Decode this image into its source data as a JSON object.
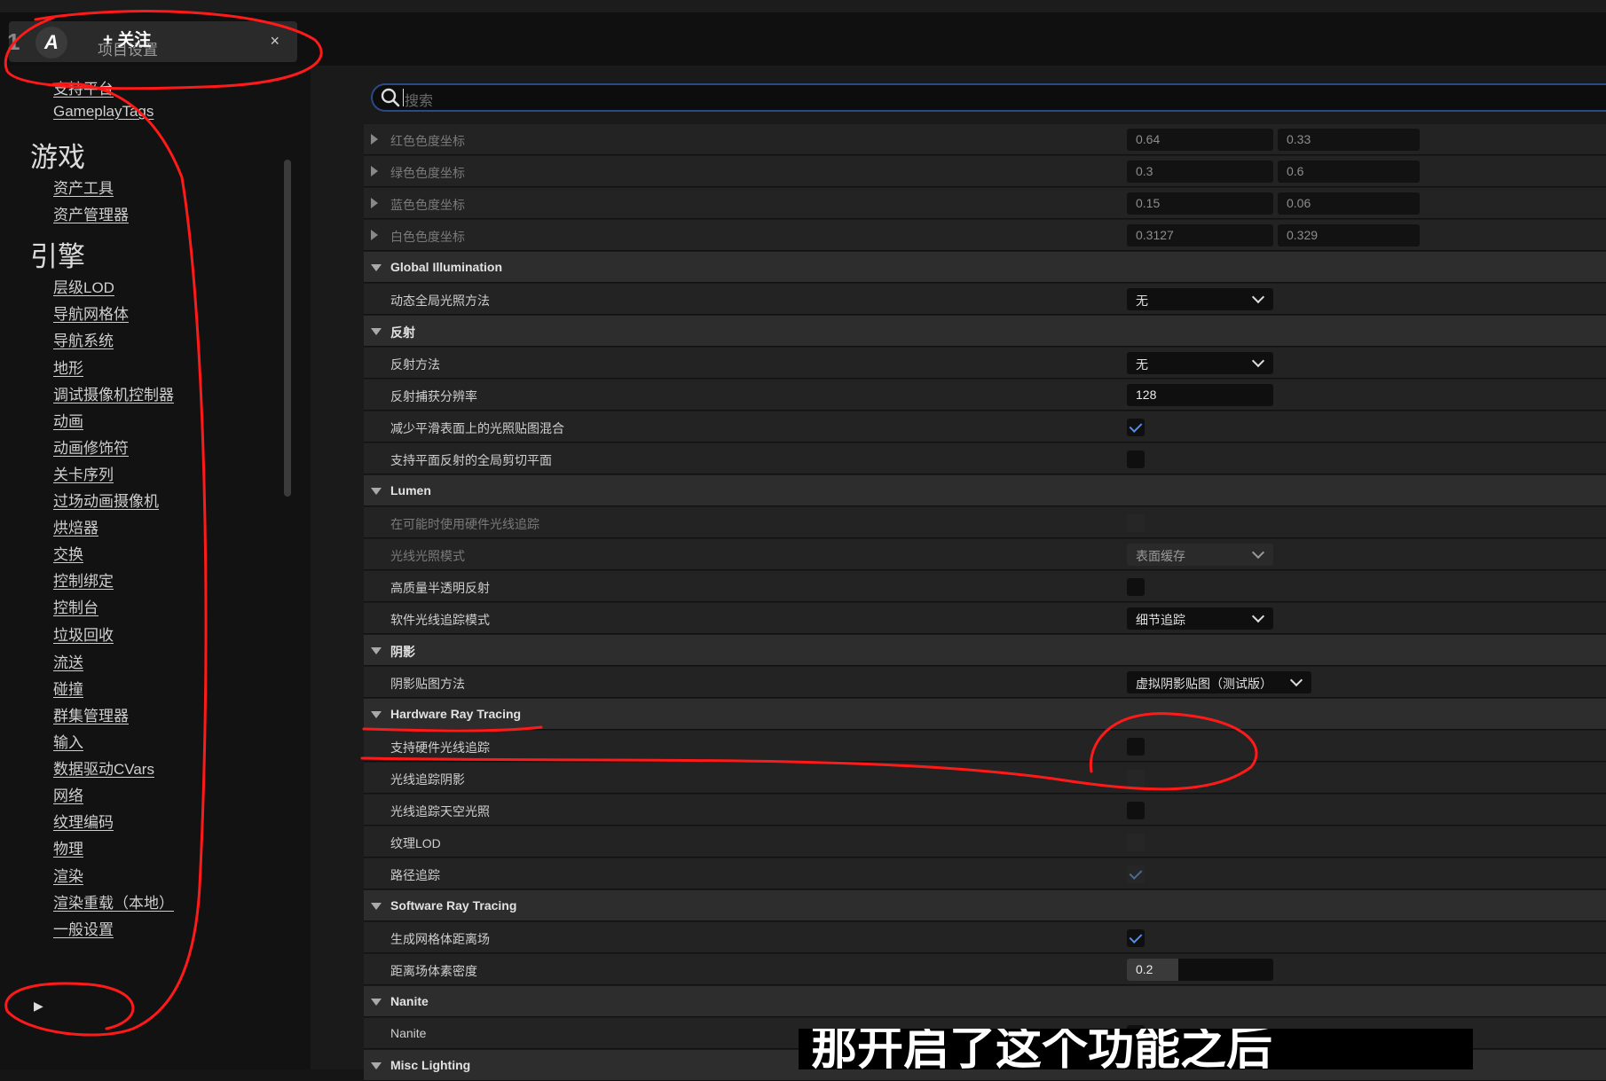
{
  "window": {
    "tab_title": "项目设置",
    "follow_label": "+ 关注",
    "close_glyph": "×",
    "app_mark": "1",
    "logo_glyph": "A"
  },
  "search": {
    "placeholder": "搜索"
  },
  "sidebar": {
    "top_items": [
      "支持平台",
      "GameplayTags"
    ],
    "cat_game": "游戏",
    "game_items": [
      "资产工具",
      "资产管理器"
    ],
    "cat_engine": "引擎",
    "engine_items": [
      "层级LOD",
      "导航网格体",
      "导航系统",
      "地形",
      "调试摄像机控制器",
      "动画",
      "动画修饰符",
      "关卡序列",
      "过场动画摄像机",
      "烘焙器",
      "交换",
      "控制绑定",
      "控制台",
      "垃圾回收",
      "流送",
      "碰撞",
      "群集管理器",
      "输入",
      "数据驱动CVars",
      "网络",
      "纹理编码",
      "物理",
      "渲染",
      "渲染重载（本地）",
      "一般设置"
    ],
    "selected": "渲染"
  },
  "chromaticity": [
    {
      "label": "红色色度坐标",
      "x": "0.64",
      "y": "0.33"
    },
    {
      "label": "绿色色度坐标",
      "x": "0.3",
      "y": "0.6"
    },
    {
      "label": "蓝色色度坐标",
      "x": "0.15",
      "y": "0.06"
    },
    {
      "label": "白色色度坐标",
      "x": "0.3127",
      "y": "0.329"
    }
  ],
  "sections": {
    "gi": "Global Illumination",
    "reflection": "反射",
    "lumen": "Lumen",
    "shadow": "阴影",
    "hrt": "Hardware Ray Tracing",
    "srt": "Software Ray Tracing",
    "nanite": "Nanite",
    "misc": "Misc Lighting"
  },
  "props": {
    "gi_method": {
      "label": "动态全局光照方法",
      "value": "无"
    },
    "refl_method": {
      "label": "反射方法",
      "value": "无"
    },
    "refl_res": {
      "label": "反射捕获分辨率",
      "value": "128"
    },
    "reduce_blend": {
      "label": "减少平滑表面上的光照贴图混合",
      "checked": true
    },
    "planar_clip": {
      "label": "支持平面反射的全局剪切平面",
      "checked": false
    },
    "lumen_hw": {
      "label": "在可能时使用硬件光线追踪",
      "checked": false
    },
    "lumen_mode": {
      "label": "光线光照模式",
      "value": "表面缓存"
    },
    "hq_translucent": {
      "label": "高质量半透明反射",
      "checked": false
    },
    "sw_trace_mode": {
      "label": "软件光线追踪模式",
      "value": "细节追踪"
    },
    "shadow_method": {
      "label": "阴影贴图方法",
      "value": "虚拟阴影贴图（测试版）"
    },
    "hrt_support": {
      "label": "支持硬件光线追踪",
      "checked": false
    },
    "rt_shadows": {
      "label": "光线追踪阴影",
      "checked": false
    },
    "rt_skylight": {
      "label": "光线追踪天空光照",
      "checked": false
    },
    "tex_lod": {
      "label": "纹理LOD",
      "checked": false
    },
    "path_tracing": {
      "label": "路径追踪",
      "checked": true
    },
    "gen_df": {
      "label": "生成网格体距离场",
      "checked": true
    },
    "df_density": {
      "label": "距离场体素密度",
      "value": "0.2",
      "fraction": 0.35
    },
    "nanite": {
      "label": "Nanite",
      "checked": true
    }
  },
  "subtitle": "那开启了这个功能之后",
  "colors": {
    "accent": "#4d8ef0",
    "search_border": "#2a4a86",
    "annotation": "#ff1a1a"
  }
}
